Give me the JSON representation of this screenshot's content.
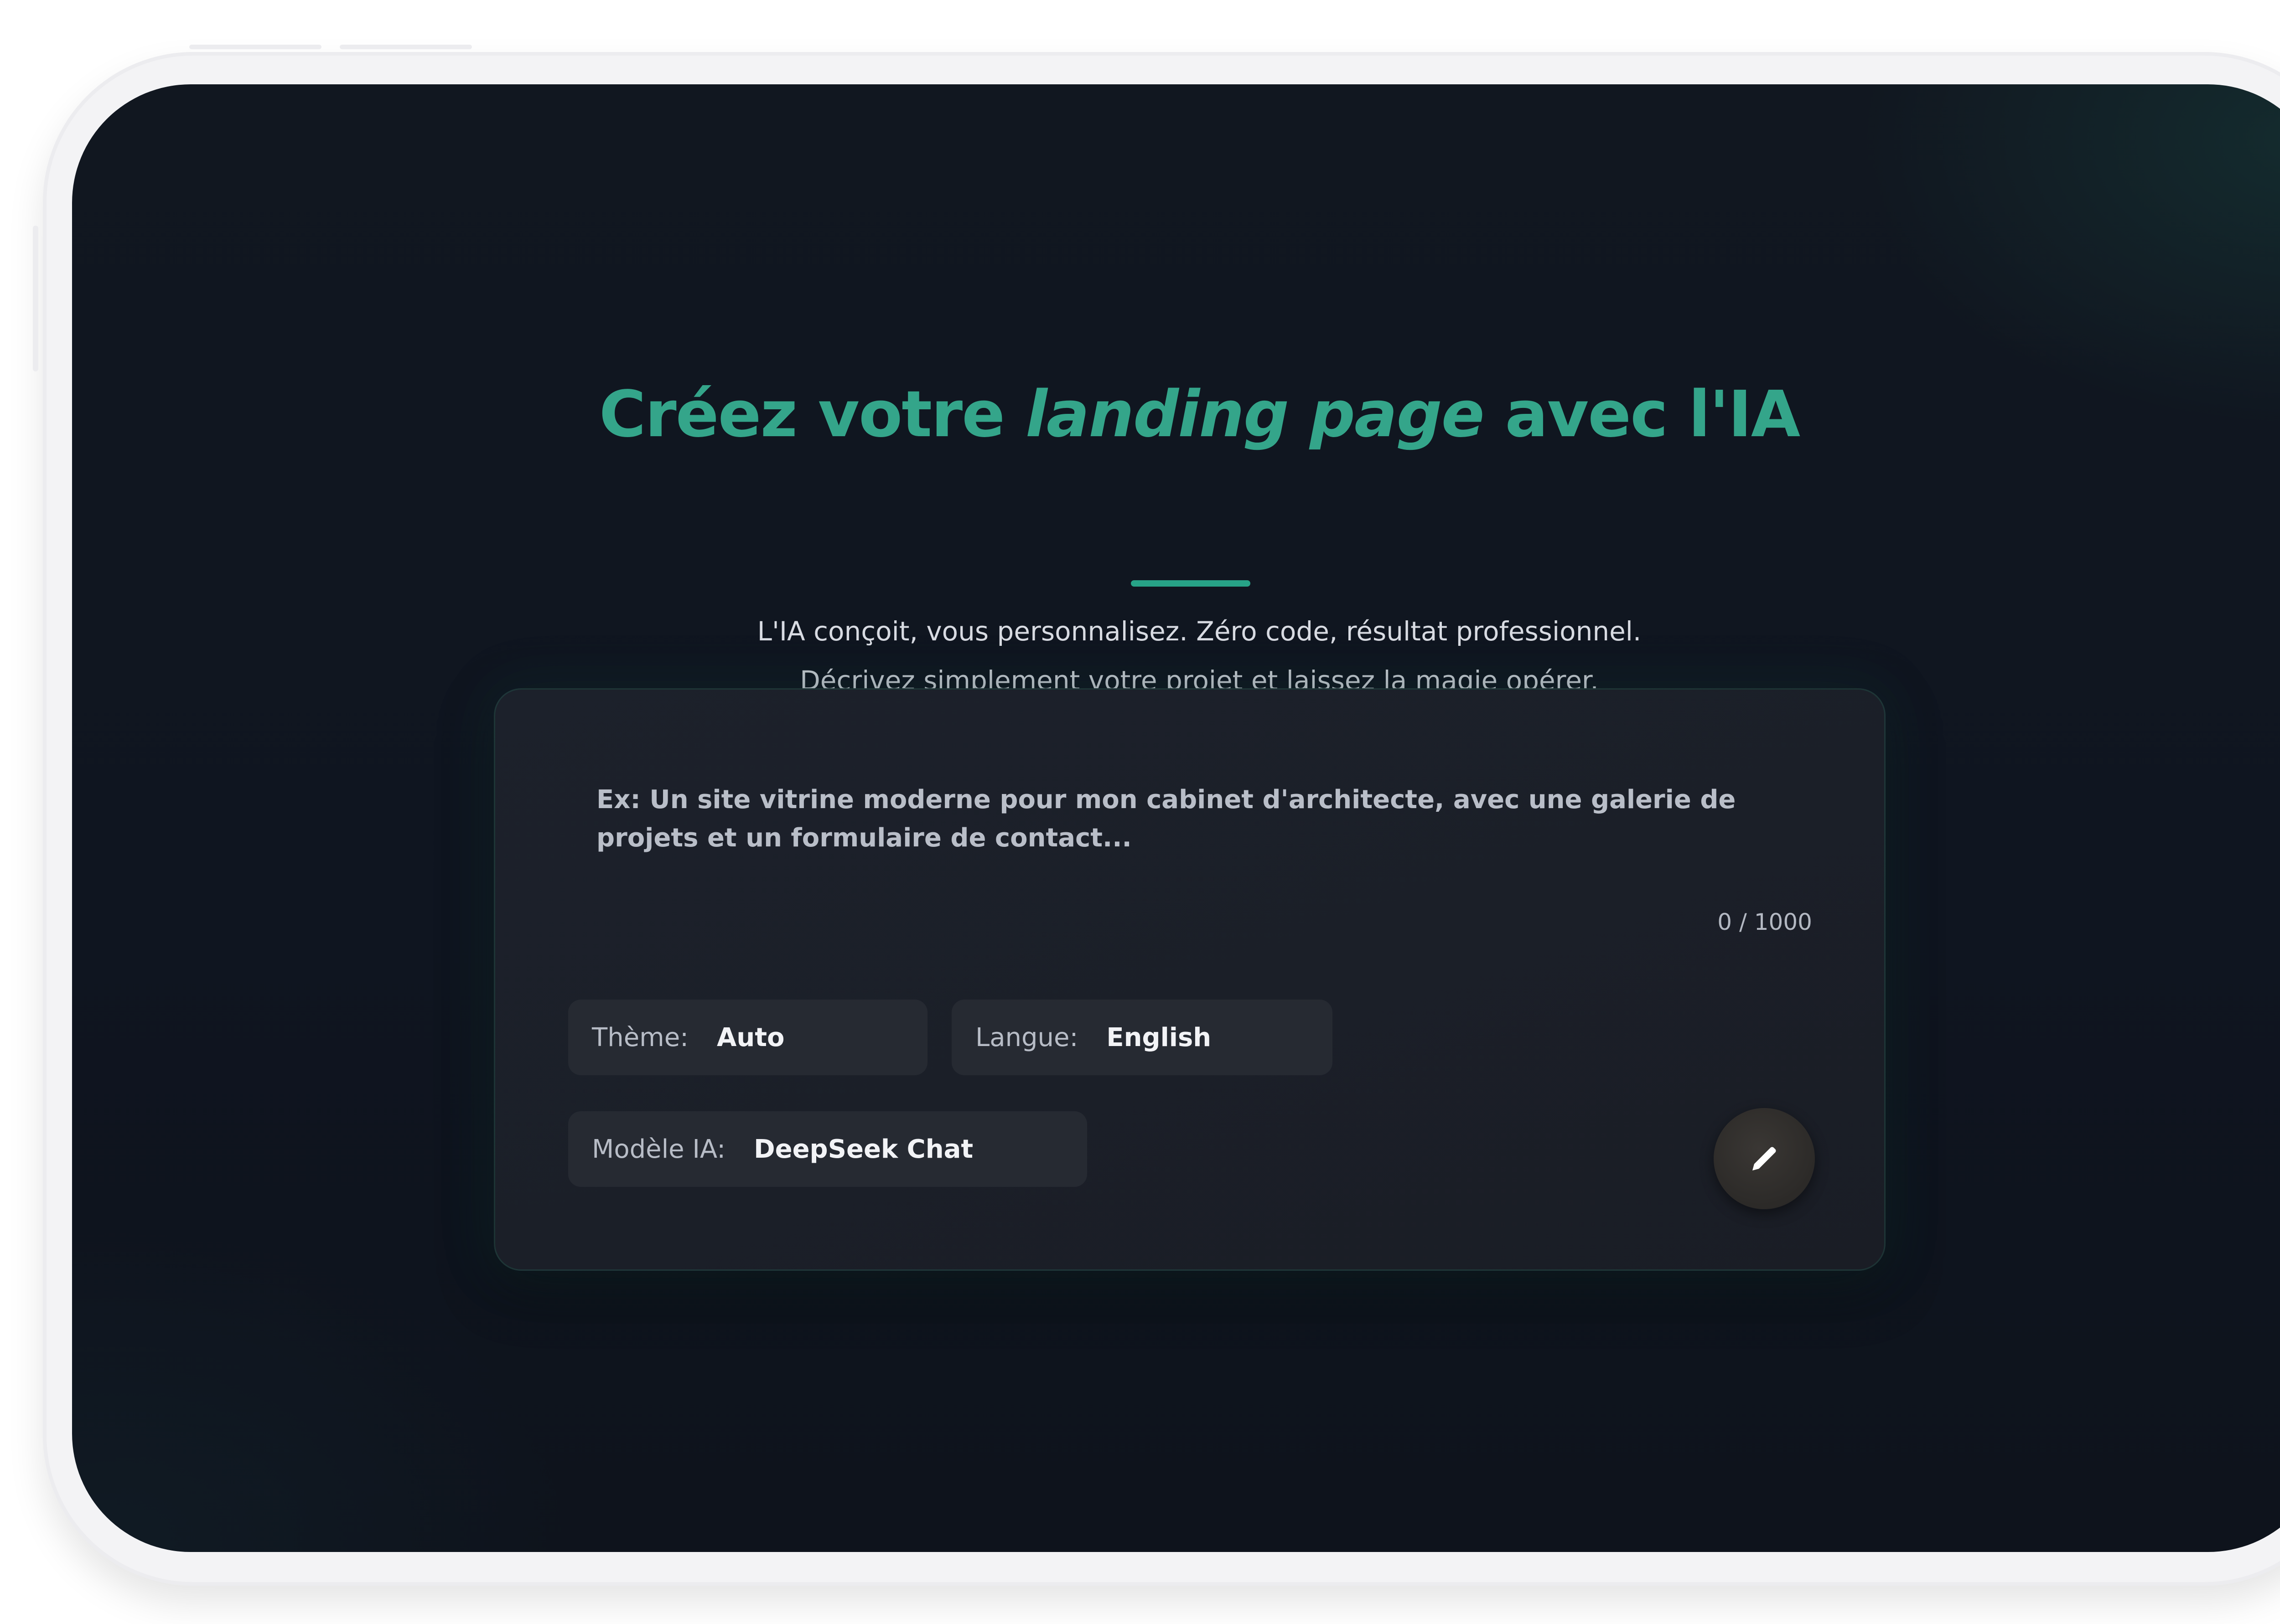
{
  "hero": {
    "title_before": "Créez votre",
    "title_accent": "landing page",
    "title_after": "avec l'IA",
    "subtitle_line1": "L'IA conçoit, vous personnalisez. Zéro code, résultat professionnel.",
    "subtitle_line2": "Décrivez simplement votre projet et laissez la magie opérer."
  },
  "prompt": {
    "placeholder": "Ex: Un site vitrine moderne pour mon cabinet d'architecte, avec une galerie de projets et un formulaire de contact...",
    "value": "",
    "counter": "0 / 1000"
  },
  "options": {
    "theme": {
      "label": "Thème:",
      "value": "Auto"
    },
    "language": {
      "label": "Langue:",
      "value": "English"
    },
    "model": {
      "label": "Modèle IA:",
      "value": "DeepSeek Chat"
    }
  },
  "generate_button": {
    "icon": "pencil-icon"
  },
  "colors": {
    "accent": "#34a58a",
    "screen_background": "#111720",
    "card_background": "#1c212b",
    "chip_background": "#262a32",
    "device_frame": "#f3f3f5"
  }
}
